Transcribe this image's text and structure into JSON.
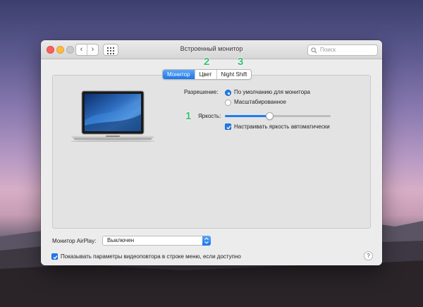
{
  "window": {
    "title": "Встроенный монитор",
    "search_placeholder": "Поиск",
    "nav_back_glyph": "‹",
    "nav_forward_glyph": "›"
  },
  "tabs": [
    {
      "label": "Монитор",
      "active": true
    },
    {
      "label": "Цвет",
      "active": false
    },
    {
      "label": "Night Shift",
      "active": false
    }
  ],
  "annotations": [
    "1",
    "2",
    "3"
  ],
  "display": {
    "resolution_label": "Разрешение:",
    "resolution_options": [
      "По умолчанию для монитора",
      "Масштабированное"
    ],
    "resolution_selected": 0,
    "brightness_label": "Яркость:",
    "brightness_level": 0.42,
    "auto_brightness_label": "Настраивать яркость автоматически",
    "auto_brightness_checked": true
  },
  "airplay": {
    "label": "Монитор AirPlay:",
    "value": "Выключен"
  },
  "mirroring": {
    "label": "Показывать параметры видеоповтора в строке меню, если доступно",
    "checked": true
  },
  "help_glyph": "?",
  "colors": {
    "accent": "#1e7cf0",
    "annotation": "#3bbf71"
  },
  "icons": [
    "search-icon",
    "grid-icon",
    "laptop-icon",
    "chevron-up-down-icon",
    "checkmark-icon"
  ]
}
